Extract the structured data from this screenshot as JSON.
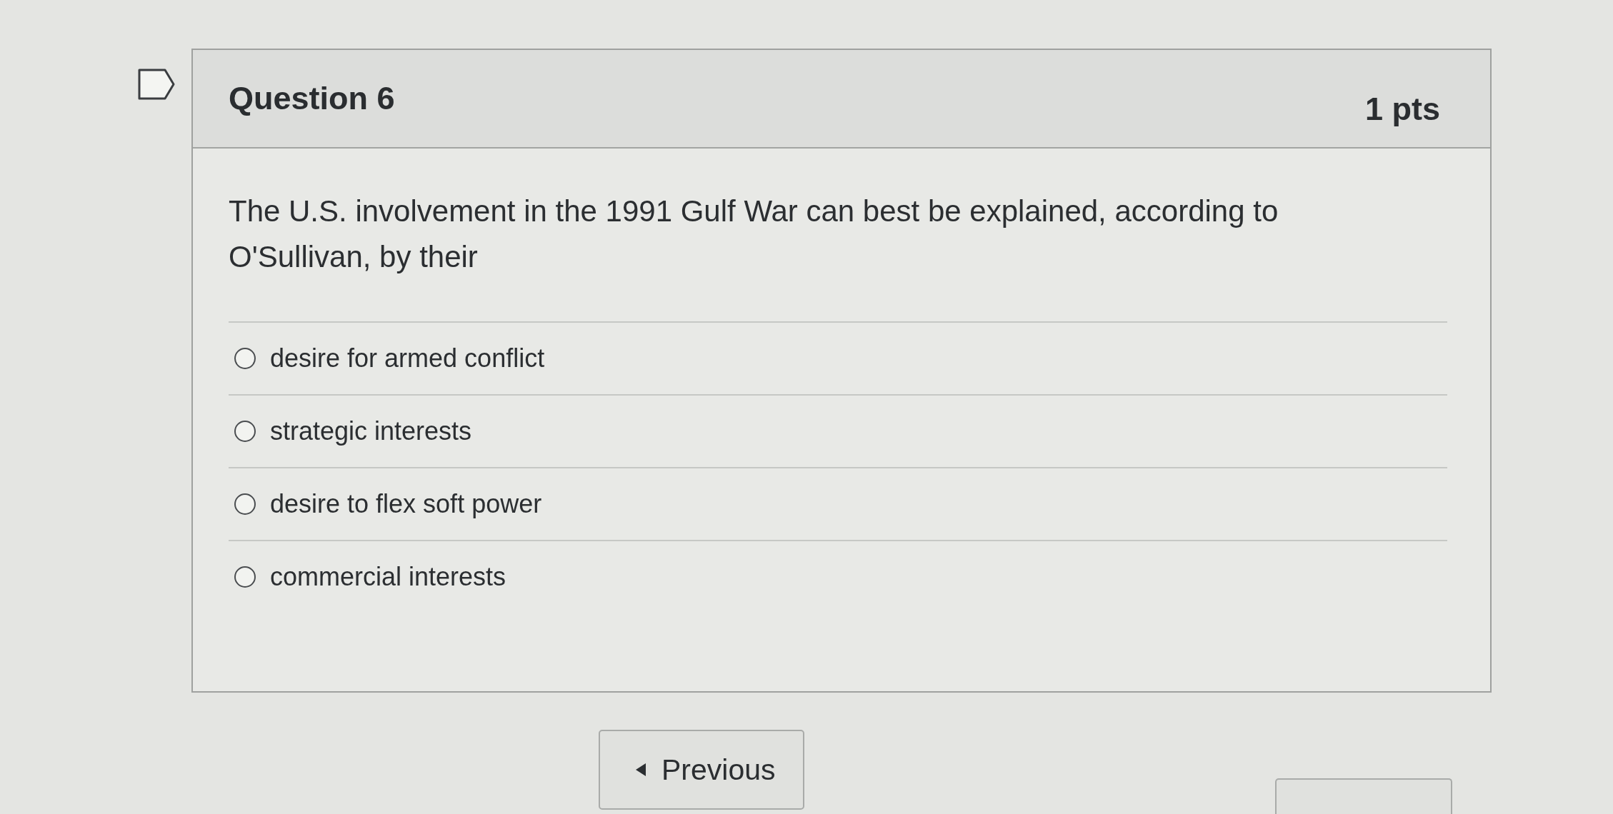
{
  "question": {
    "flagged": false,
    "title": "Question 6",
    "points": "1 pts",
    "text": "The U.S. involvement in the 1991 Gulf War can best be explained, according to O'Sullivan, by their",
    "options": [
      {
        "label": "desire for armed conflict",
        "selected": false
      },
      {
        "label": "strategic interests",
        "selected": false
      },
      {
        "label": "desire to flex soft power",
        "selected": false
      },
      {
        "label": "commercial interests",
        "selected": false
      }
    ]
  },
  "navigation": {
    "previous": {
      "label": "Previous"
    }
  }
}
